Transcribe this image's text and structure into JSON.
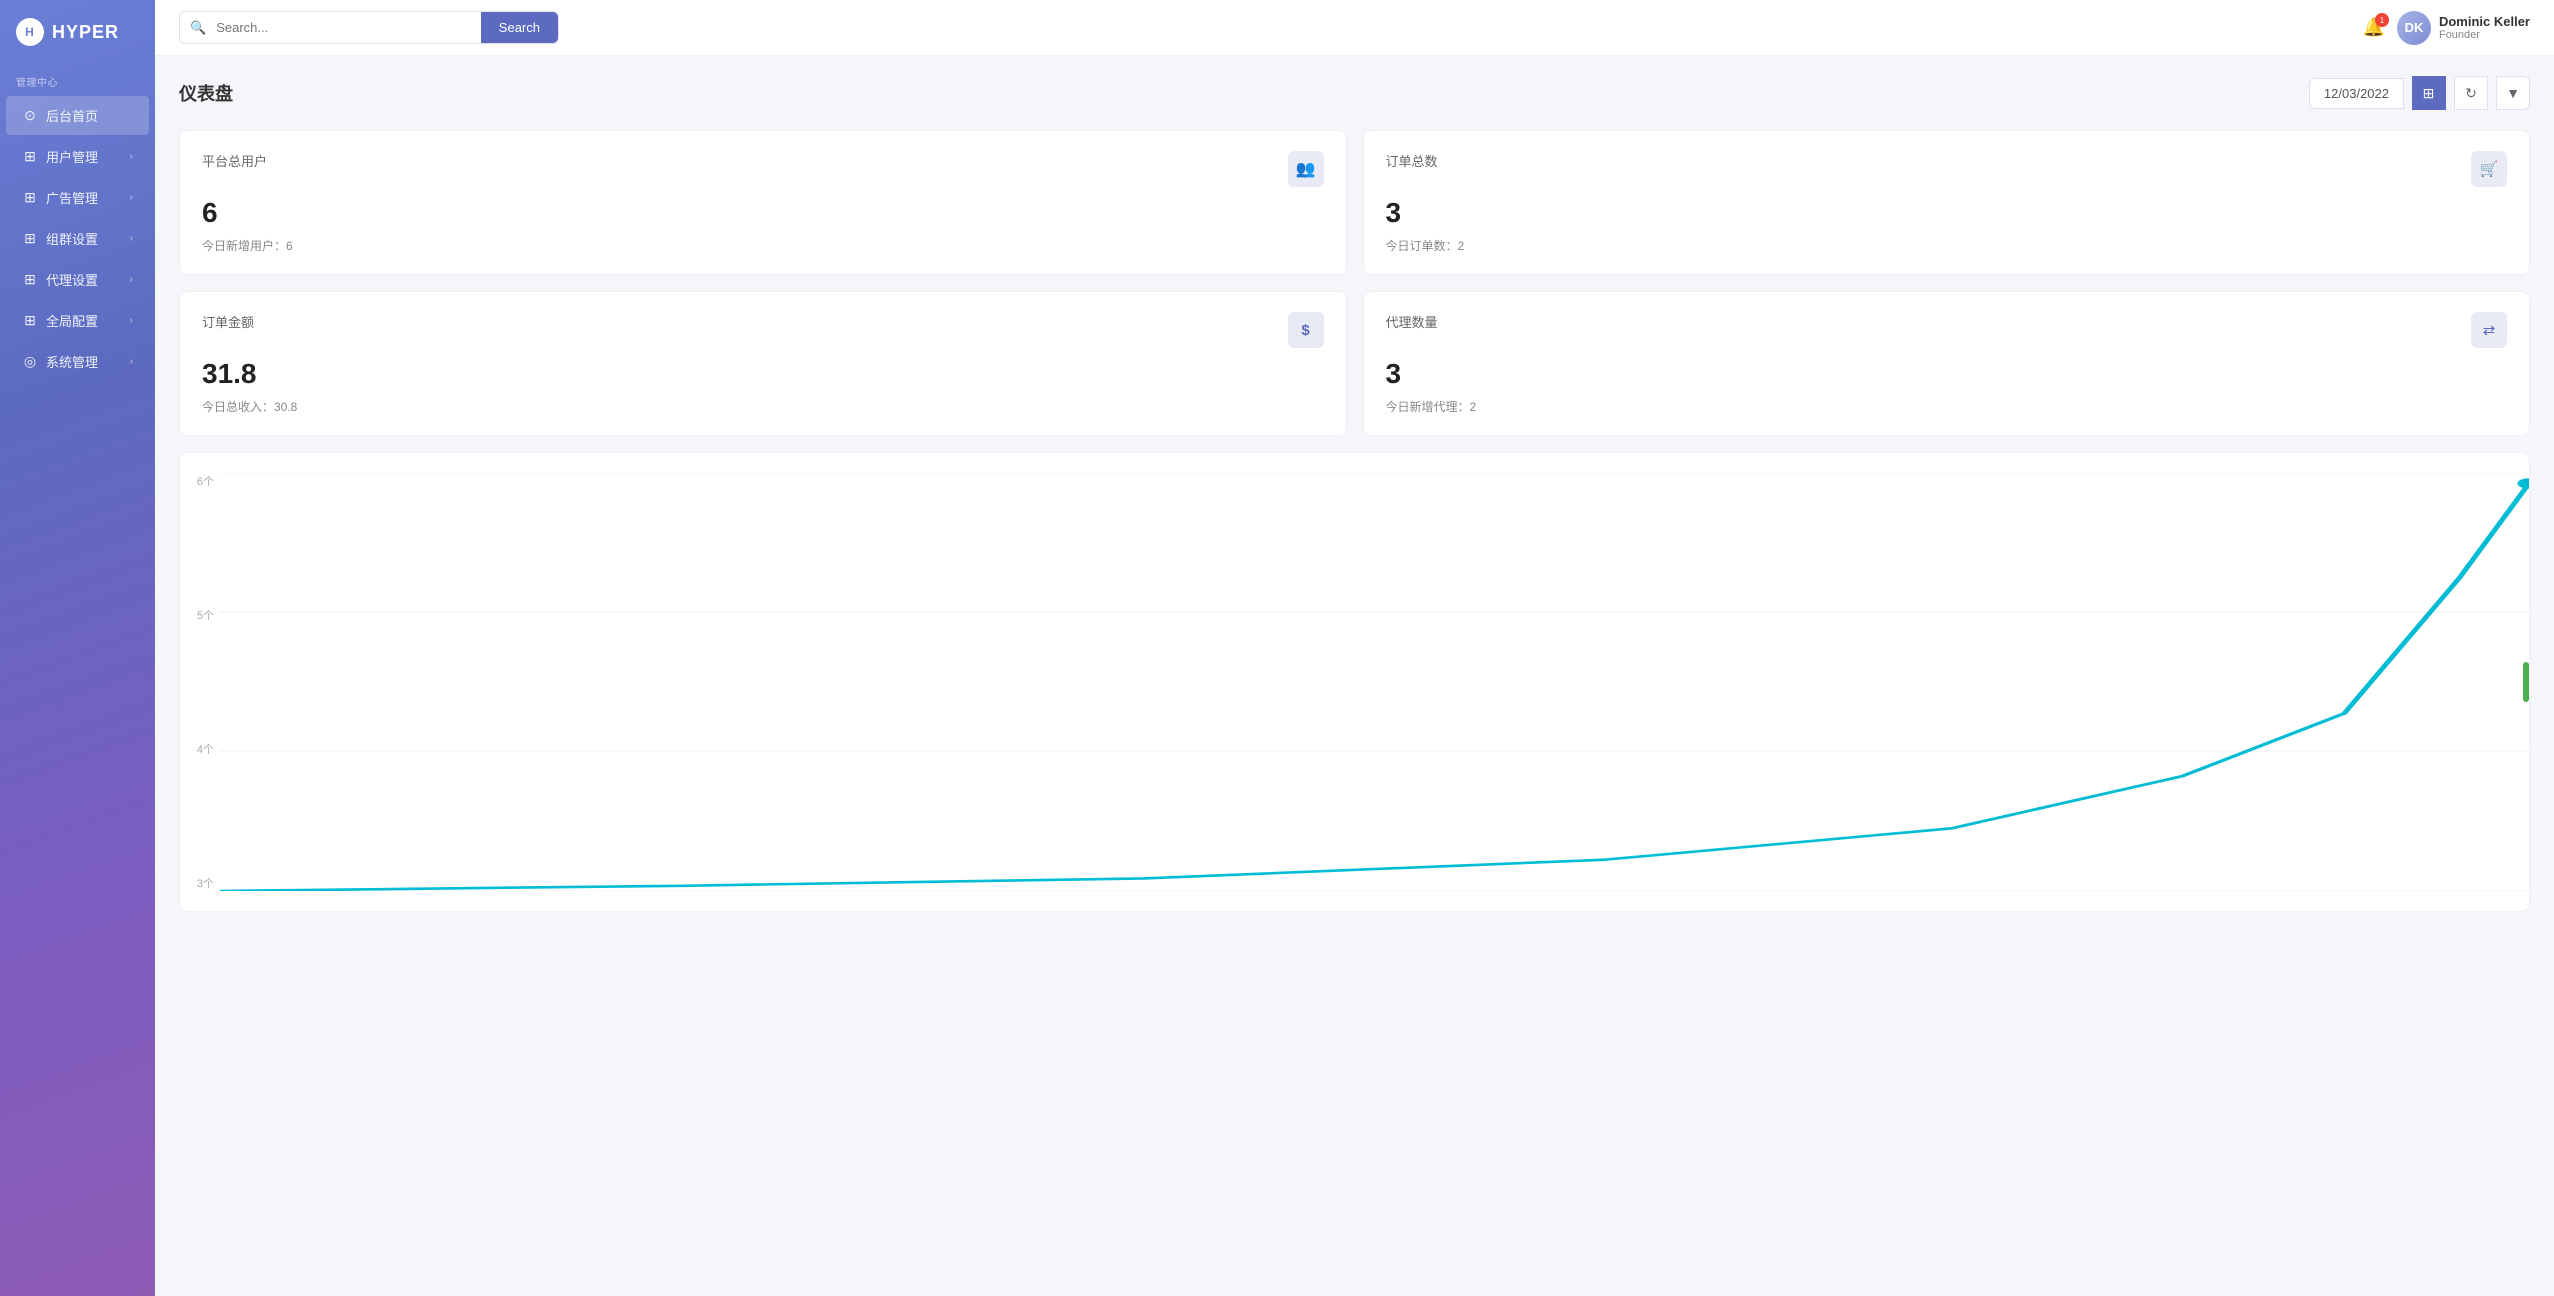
{
  "app": {
    "logo_text": "HYPER",
    "logo_icon": "H"
  },
  "sidebar": {
    "section_label": "管理中心",
    "items": [
      {
        "id": "home",
        "label": "后台首页",
        "icon": "⊙",
        "has_chevron": false,
        "active": true
      },
      {
        "id": "users",
        "label": "用户管理",
        "icon": "⊞",
        "has_chevron": true,
        "active": false
      },
      {
        "id": "ads",
        "label": "广告管理",
        "icon": "⊞",
        "has_chevron": true,
        "active": false
      },
      {
        "id": "group",
        "label": "组群设置",
        "icon": "⊞",
        "has_chevron": true,
        "active": false
      },
      {
        "id": "agent",
        "label": "代理设置",
        "icon": "⊞",
        "has_chevron": true,
        "active": false
      },
      {
        "id": "global",
        "label": "全局配置",
        "icon": "⊞",
        "has_chevron": true,
        "active": false
      },
      {
        "id": "system",
        "label": "系统管理",
        "icon": "◎",
        "has_chevron": true,
        "active": false
      }
    ]
  },
  "header": {
    "search_placeholder": "Search...",
    "search_button_label": "Search",
    "notification_count": "1",
    "user": {
      "name": "Dominic Keller",
      "role": "Founder",
      "initials": "DK"
    }
  },
  "page": {
    "title": "仪表盘",
    "date": "12/03/2022"
  },
  "stats": [
    {
      "id": "total-users",
      "title": "平台总用户",
      "value": "6",
      "sub": "今日新增用户：6",
      "icon": "👥"
    },
    {
      "id": "total-orders",
      "title": "订单总数",
      "value": "3",
      "sub": "今日订单数：2",
      "icon": "🛒"
    },
    {
      "id": "order-amount",
      "title": "订单金额",
      "value": "31.8",
      "sub": "今日总收入：30.8",
      "icon": "$"
    },
    {
      "id": "agent-count",
      "title": "代理数量",
      "value": "3",
      "sub": "今日新增代理：2",
      "icon": "⇄"
    }
  ],
  "chart": {
    "y_labels": [
      "6个",
      "5个",
      "4个",
      "3个"
    ],
    "line_color": "#00bcd4",
    "indicator_color": "#4caf50"
  }
}
